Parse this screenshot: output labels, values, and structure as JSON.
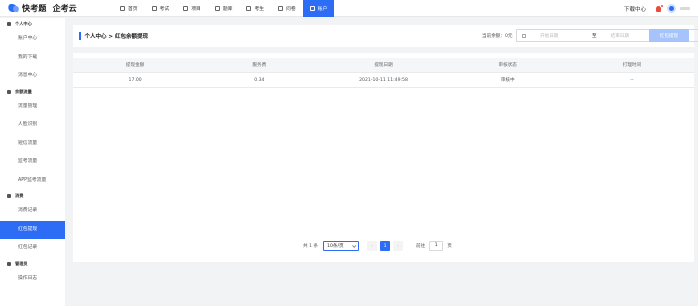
{
  "app": {
    "logo_text": "快考题",
    "logo_text2": "企考云"
  },
  "nav": [
    {
      "label": "首页",
      "icon": "home-icon"
    },
    {
      "label": "考试",
      "icon": "exam-icon"
    },
    {
      "label": "项目",
      "icon": "project-icon"
    },
    {
      "label": "题库",
      "icon": "question-bank-icon"
    },
    {
      "label": "考生",
      "icon": "candidate-icon"
    },
    {
      "label": "问卷",
      "icon": "survey-icon"
    },
    {
      "label": "账户",
      "icon": "account-icon",
      "active": true
    }
  ],
  "topright": {
    "download": "下载中心"
  },
  "sidebar": {
    "groups": [
      {
        "title": "个人中心",
        "icon": "user-icon",
        "items": [
          "账户中心",
          "我的下载",
          "消息中心"
        ]
      },
      {
        "title": "余额流量",
        "icon": "balance-icon",
        "items": [
          "流量管理",
          "人脸识别",
          "短信流量",
          "监考流量",
          "APP监考流量"
        ]
      },
      {
        "title": "消费",
        "icon": "consume-icon",
        "items": [
          "消费记录",
          "红包提现",
          "红包记录"
        ]
      },
      {
        "title": "管理员",
        "icon": "admin-icon",
        "items": [
          "操作日志"
        ]
      }
    ],
    "active_item": "红包提现"
  },
  "header": {
    "breadcrumb": "个人中心 > 红包余额提现",
    "balance_label": "当前余额：0元",
    "date_start_placeholder": "开始日期",
    "date_sep": "至",
    "date_end_placeholder": "结束日期",
    "withdraw_button": "红包提现"
  },
  "table": {
    "columns": [
      "提现金额",
      "服务费",
      "提现日期",
      "审核状态",
      "打理时间"
    ],
    "rows": [
      [
        "17.00",
        "0.34",
        "2021-10-11 11:49:58",
        "审核中",
        "--"
      ]
    ]
  },
  "pagination": {
    "total": "共 1 条",
    "page_size": "10条/页",
    "prev": "‹",
    "current_page": "1",
    "next": "›",
    "goto_label": "前往",
    "goto_value": "1",
    "page_suffix": "页"
  },
  "colors": {
    "primary": "#2d6df6",
    "primary_light": "#a6c4fb"
  }
}
